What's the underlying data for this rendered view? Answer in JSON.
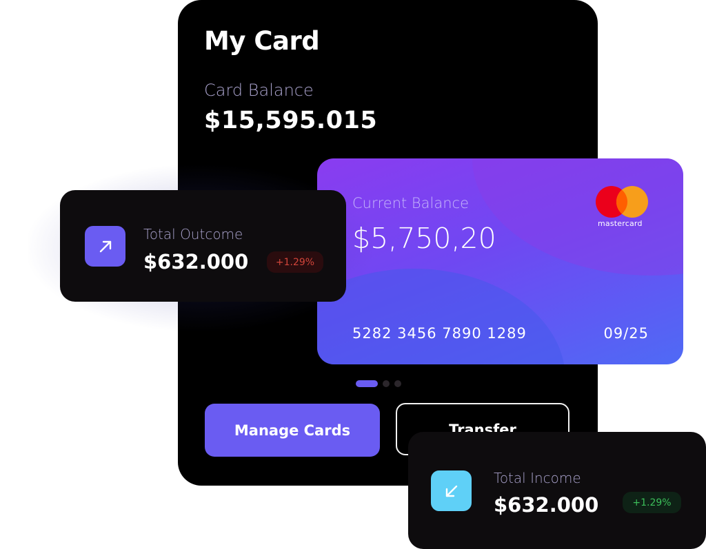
{
  "my_card": {
    "title": "My Card",
    "balance_label": "Card Balance",
    "balance_value": "$15,595.015",
    "manage_label": "Manage Cards",
    "transfer_label": "Transfer"
  },
  "credit_card": {
    "label": "Current Balance",
    "value": "$5,750,20",
    "number": "5282 3456 7890 1289",
    "expiry": "09/25",
    "brand": "mastercard",
    "gradient_colors": [
      "#8a3cf0",
      "#6f48f2",
      "#4f6af5"
    ]
  },
  "pagination": {
    "count": 3,
    "active_index": 0
  },
  "outcome": {
    "label": "Total Outcome",
    "value": "$632.000",
    "change": "+1.29%",
    "icon": "arrow-up-right-icon",
    "accent": "#6a5cf2",
    "change_color": "#d2453a"
  },
  "income": {
    "label": "Total Income",
    "value": "$632.000",
    "change": "+1.29%",
    "icon": "arrow-down-left-icon",
    "accent": "#5fd0f7",
    "change_color": "#3cbf5a"
  }
}
